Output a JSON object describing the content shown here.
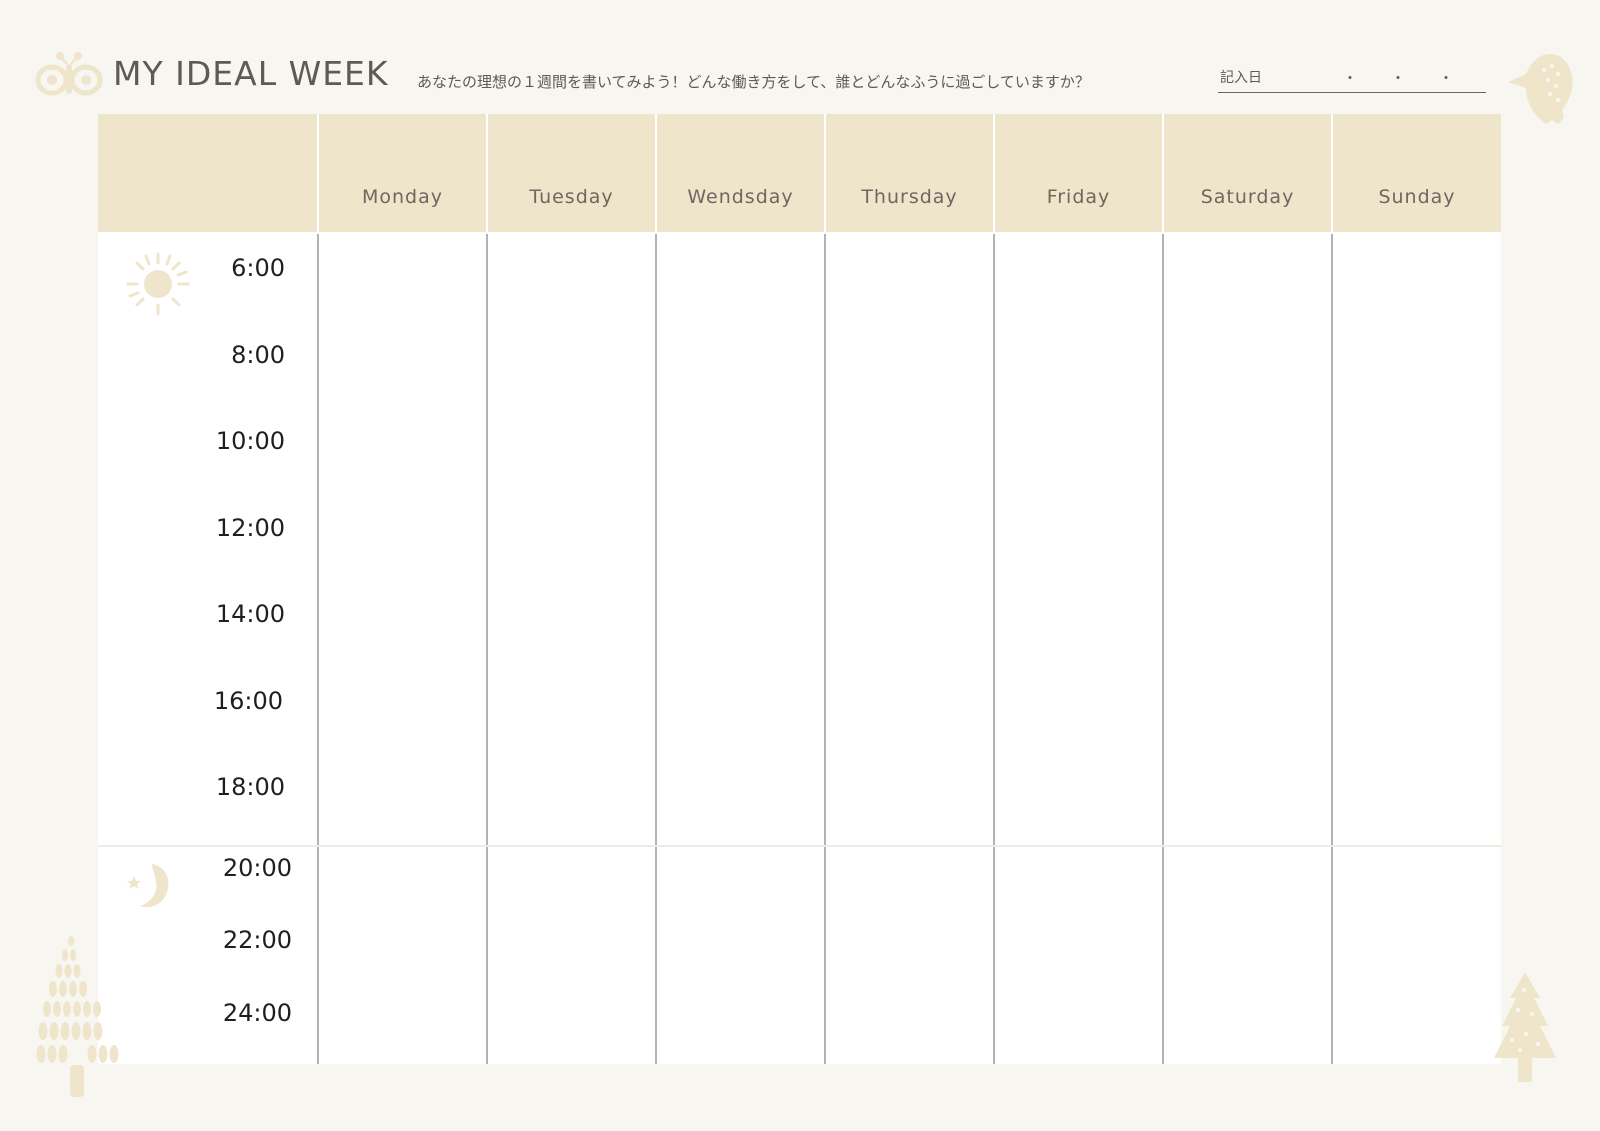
{
  "header": {
    "title": "MY IDEAL WEEK",
    "subtitle": "あなたの理想の１週間を書いてみよう！どんな働き方をして、誰とどんなふうに過ごしていますか？",
    "date_label": "記入日",
    "date_separators": [
      "・",
      "・",
      "・"
    ]
  },
  "days": [
    "Monday",
    "Tuesday",
    "Wendsday",
    "Thursday",
    "Friday",
    "Saturday",
    "Sunday"
  ],
  "day_times": [
    "6:00",
    "8:00",
    "10:00",
    "12:00",
    "14:00",
    "16:00",
    "18:00"
  ],
  "night_times": [
    "20:00",
    "22:00",
    "24:00"
  ],
  "icons": {
    "logo": "butterfly-icon",
    "corner": "bird-icon",
    "day": "sun-icon",
    "night": "moon-icon",
    "decor": "tree-icon"
  },
  "colors": {
    "background": "#f8f6f1",
    "header_band": "#efe5cb",
    "accent": "#efe5cb",
    "text": "#5f5a52",
    "grid_line": "#b3b3b3"
  }
}
